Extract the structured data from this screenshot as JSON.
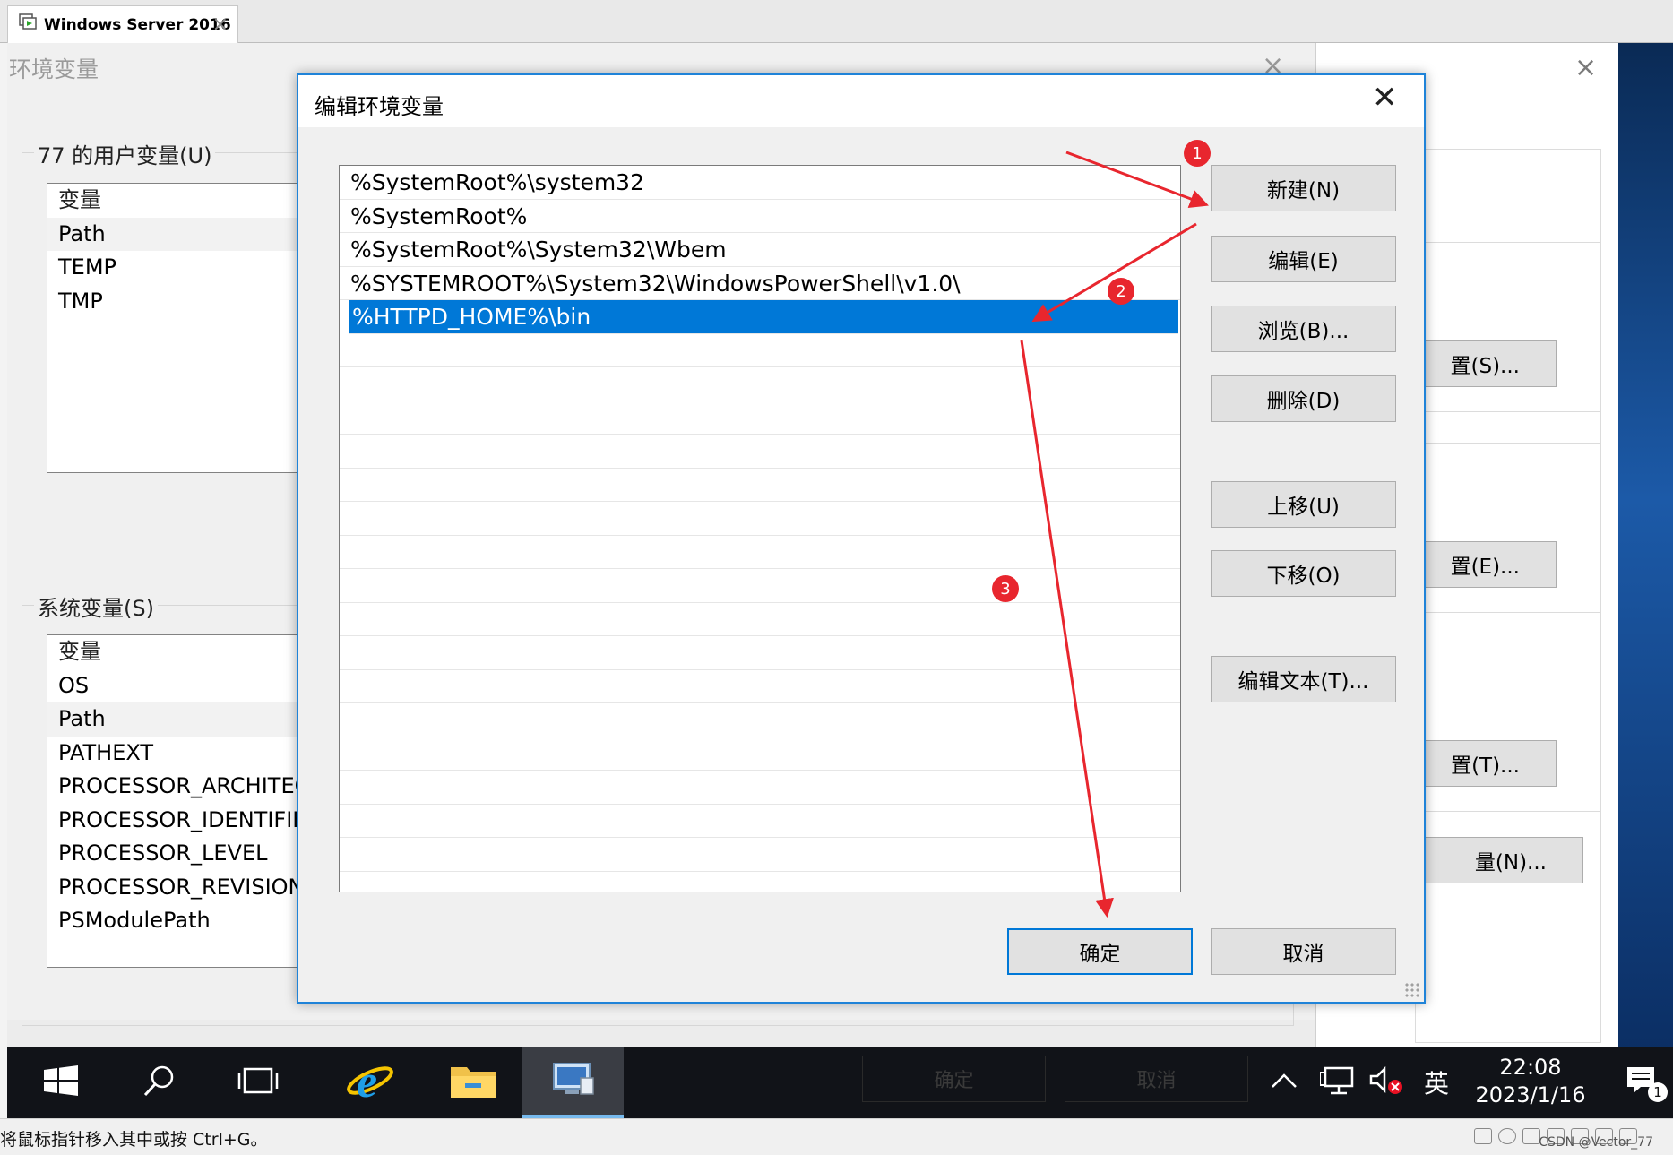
{
  "vm": {
    "tab_title": "Windows Server 2016",
    "tab_close": "×",
    "status_hint": "将鼠标指针移入其中或按 Ctrl+G。",
    "watermark": "CSDN @Vector_77"
  },
  "env_dialog": {
    "title": "环境变量",
    "close": "×",
    "user_group_label": "77 的用户变量(U)",
    "user_vars": [
      "变量",
      "Path",
      "TEMP",
      "TMP"
    ],
    "system_group_label": "系统变量(S)",
    "system_vars": [
      "变量",
      "OS",
      "Path",
      "PATHEXT",
      "PROCESSOR_ARCHITECTURE",
      "PROCESSOR_IDENTIFIER",
      "PROCESSOR_LEVEL",
      "PROCESSOR_REVISION",
      "PSModulePath"
    ]
  },
  "sys_props": {
    "close": "×",
    "btn_startup": "置(S)...",
    "btn_profiles": "置(E)...",
    "btn_perf": "置(T)...",
    "btn_env": "量(N)..."
  },
  "edit_dialog": {
    "title": "编辑环境变量",
    "close": "✕",
    "paths": [
      "%SystemRoot%\\system32",
      "%SystemRoot%",
      "%SystemRoot%\\System32\\Wbem",
      "%SYSTEMROOT%\\System32\\WindowsPowerShell\\v1.0\\",
      "%HTTPD_HOME%\\bin"
    ],
    "selected_index": 4,
    "buttons": {
      "new": "新建(N)",
      "edit": "编辑(E)",
      "browse": "浏览(B)...",
      "delete": "删除(D)",
      "move_up": "上移(U)",
      "move_down": "下移(O)",
      "edit_text": "编辑文本(T)...",
      "ok": "确定",
      "cancel": "取消"
    }
  },
  "annotations": {
    "badge_1": "1",
    "badge_2": "2",
    "badge_3": "3",
    "color": "#e8262e"
  },
  "taskbar": {
    "ghost_ok": "确定",
    "ghost_cancel": "取消",
    "ime": "英",
    "time": "22:08",
    "date": "2023/1/16",
    "notification_count": "1"
  }
}
